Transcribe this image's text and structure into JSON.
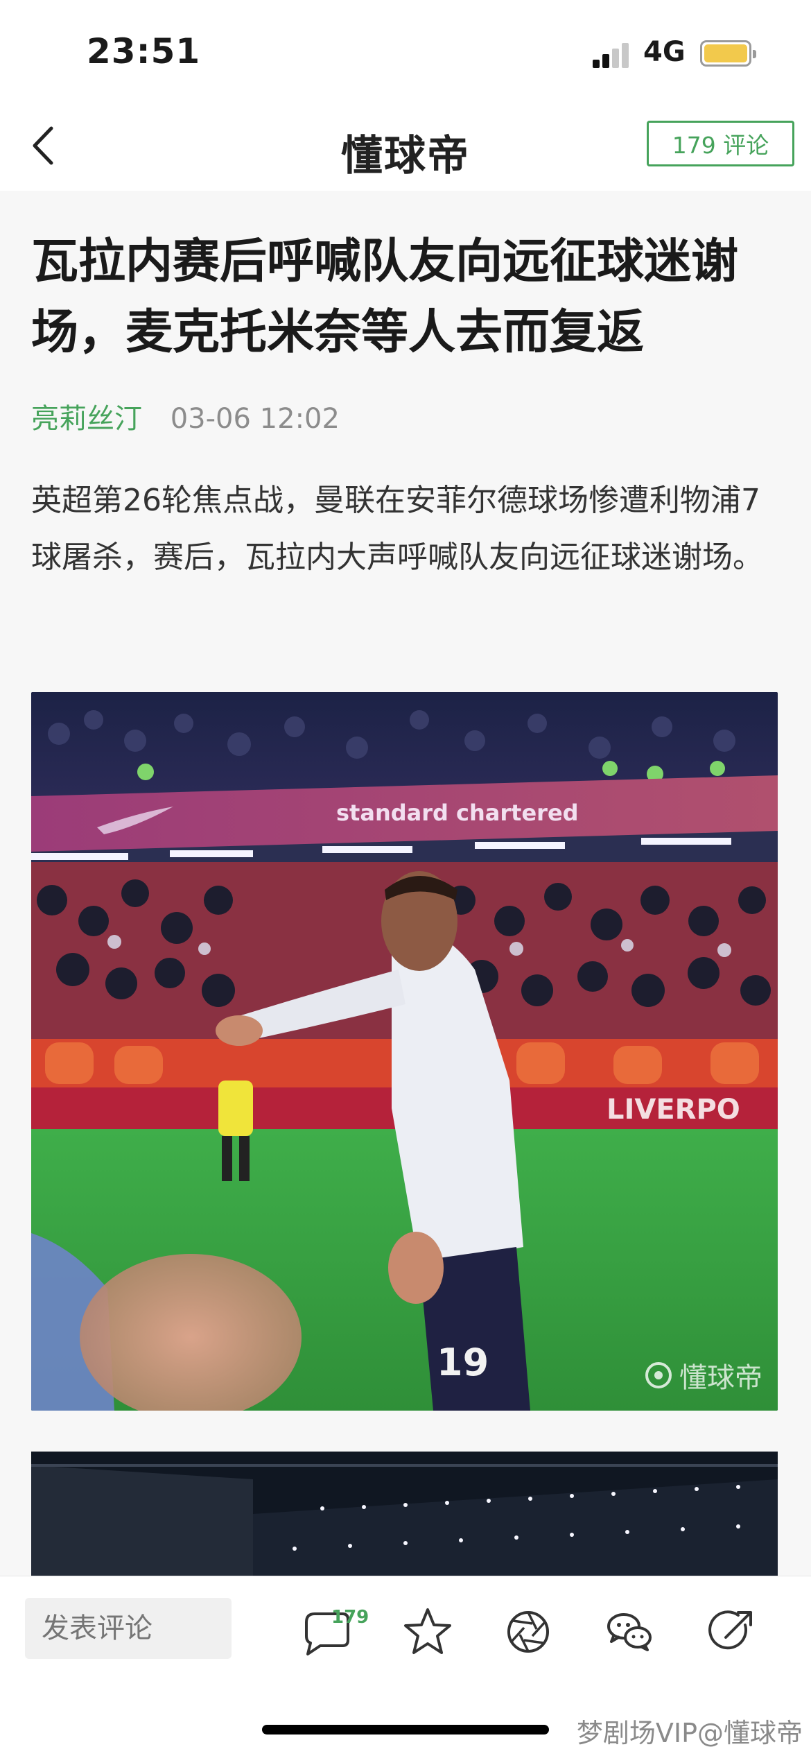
{
  "status_bar": {
    "time": "23:51",
    "network": "4G"
  },
  "nav": {
    "title": "懂球帝",
    "comment_button": "179 评论"
  },
  "article": {
    "headline": "瓦拉内赛后呼喊队友向远征球迷谢场，麦克托米奈等人去而复返",
    "author": "亮莉丝汀",
    "date": "03-06 12:02",
    "lead": "英超第26轮焦点战，曼联在安菲尔德球场惨遭利物浦7球屠杀，赛后，瓦拉内大声呼喊队友向远征球迷谢场。"
  },
  "photo": {
    "board_text": "standard chartered",
    "watermark": "懂球帝",
    "shirt_number": "19",
    "ad_text": "LIVERPO"
  },
  "toolbar": {
    "comment_placeholder": "发表评论",
    "comment_count": "179"
  },
  "footer": {
    "credit": "梦剧场VIP@懂球帝"
  },
  "colors": {
    "accent": "#46a35b",
    "text": "#1a1a1a",
    "muted": "#8c8c8c"
  },
  "icons": [
    "back-chevron-icon",
    "comment-bubble-icon",
    "star-icon",
    "camera-aperture-icon",
    "wechat-icon",
    "share-arrow-icon"
  ]
}
